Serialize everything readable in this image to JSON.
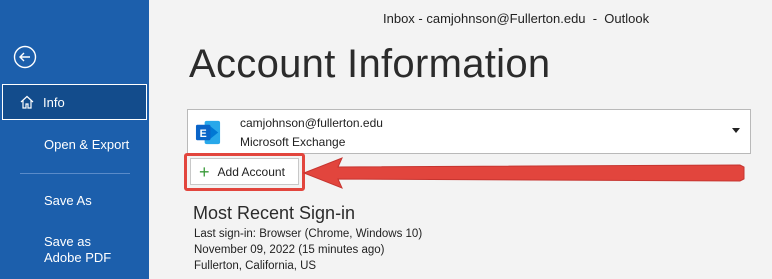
{
  "window": {
    "title": "Inbox - camjohnson@Fullerton.edu  -  Outlook"
  },
  "sidebar": {
    "back_icon": "back-arrow-circle-icon",
    "items": [
      {
        "label": "Info",
        "icon": "home-icon",
        "selected": true
      },
      {
        "label": "Open & Export"
      },
      {
        "label": "Save As"
      },
      {
        "label": "Save as Adobe PDF"
      }
    ]
  },
  "main": {
    "title": "Account Information",
    "account": {
      "email": "camjohnson@fullerton.edu",
      "type": "Microsoft Exchange",
      "icon": "exchange-icon"
    },
    "add_account_label": "Add Account",
    "recent": {
      "title": "Most Recent Sign-in",
      "lines": [
        "Last sign-in: Browser (Chrome, Windows 10)",
        "November 09, 2022 (15 minutes ago)",
        "Fullerton, California, US"
      ]
    }
  },
  "colors": {
    "sidebar_bg": "#1c5fac",
    "selected_bg": "#134c8c",
    "annotation_red": "#e2453d",
    "exchange_blue": "#0a64c8"
  }
}
